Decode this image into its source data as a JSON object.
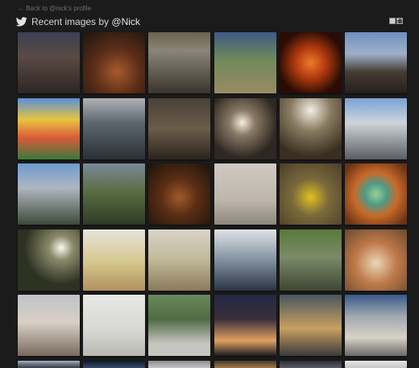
{
  "back_link": "← Back to @nick's profile",
  "header": {
    "title_prefix": "Recent images by ",
    "handle": "@Nick"
  },
  "icons": {
    "brand": "twitter-bird-icon",
    "view_toggle": "grid-view-icon"
  },
  "colors": {
    "background": "#1b1b1b",
    "twitter_bird": "#e2e2e2"
  },
  "thumbnails": [
    {
      "subject": "victorian-houses",
      "bg": "linear-gradient(180deg,#3b3f55 0%,#5a4a44 40%,#2b2724 100%)"
    },
    {
      "subject": "dinner-table",
      "bg": "radial-gradient(circle at 55% 65%,#a85a2c 0%,#5a2d18 45%,#1e1410 100%)"
    },
    {
      "subject": "workshop-sign",
      "bg": "linear-gradient(180deg,#6b6150 0%,#8a8578 30%,#3a342c 100%)"
    },
    {
      "subject": "cabin-in-trees",
      "bg": "linear-gradient(180deg,#3f5a86 0%,#6f8a5a 45%,#9a8a64 100%)"
    },
    {
      "subject": "guy-fawkes-pumpkin",
      "bg": "radial-gradient(circle at 50% 50%,#f07a2a 0%,#b13a0e 35%,#2a0c05 75%)"
    },
    {
      "subject": "festival-crowd",
      "bg": "linear-gradient(180deg,#6f8fbf 0%,#9fb0c8 35%,#463c36 65%,#241e1a 100%)"
    },
    {
      "subject": "cartoon-mural",
      "bg": "linear-gradient(180deg,#5a8fd8 0%,#e8c440 35%,#d85a3a 65%,#3a7a3a 100%)"
    },
    {
      "subject": "parking-garage",
      "bg": "linear-gradient(180deg,#b0b2b4 0%,#5d6770 40%,#2a3034 100%)"
    },
    {
      "subject": "dim-room",
      "bg": "linear-gradient(180deg,#4a4038 0%,#6b5c4a 50%,#2a241e 100%)"
    },
    {
      "subject": "lamp-light",
      "bg": "radial-gradient(circle at 45% 40%,#f6eede 0%,#8a7a66 25%,#2e2822 70%)"
    },
    {
      "subject": "window-backlit",
      "bg": "radial-gradient(circle at 50% 20%,#f2eee4 0%,#8a7c62 35%,#3a2e20 80%)"
    },
    {
      "subject": "office-building",
      "bg": "linear-gradient(180deg,#7aa2d6 0%,#cfd4da 40%,#5a5e62 100%)"
    },
    {
      "subject": "h-sign-building",
      "bg": "linear-gradient(180deg,#6e9ad0 0%,#aeb6bf 40%,#3e4a3a 100%)"
    },
    {
      "subject": "man-in-tshirt",
      "bg": "linear-gradient(180deg,#7a8a9a 0%,#5a6e44 45%,#2e3a22 100%)"
    },
    {
      "subject": "bbq-ribs",
      "bg": "radial-gradient(circle at 50% 55%,#a05a2a 0%,#5a2e14 40%,#1c120c 100%)"
    },
    {
      "subject": "paper-document",
      "bg": "linear-gradient(180deg,#cfcac2 0%,#bdb6aa 60%,#8e877c 100%)"
    },
    {
      "subject": "yellow-shirt",
      "bg": "radial-gradient(circle at 50% 55%,#e0c020 0%,#7a6a3a 40%,#4a3e2a 100%)"
    },
    {
      "subject": "plate-on-table",
      "bg": "radial-gradient(circle at 50% 50%,#9acf9a 0%,#4f9a86 25%,#c86a2a 50%,#6a3214 90%)"
    },
    {
      "subject": "sunburst-trees",
      "bg": "radial-gradient(circle at 70% 30%,#fafaf0 0%,#8a8a6a 20%,#2e3222 60%)"
    },
    {
      "subject": "apple-plate",
      "bg": "linear-gradient(180deg,#e6e4dc 0%,#d4c68a 55%,#b09060 100%)"
    },
    {
      "subject": "food-plate",
      "bg": "linear-gradient(180deg,#d8d4c8 0%,#c0b898 50%,#8a7a5a 100%)"
    },
    {
      "subject": "man-in-office",
      "bg": "linear-gradient(180deg,#dfe2e6 0%,#8b9aa8 45%,#2a3442 100%)"
    },
    {
      "subject": "creek",
      "bg": "linear-gradient(180deg,#5a7a3a 0%,#7a8a6a 45%,#3e4632 100%)"
    },
    {
      "subject": "breakfast-plate",
      "bg": "radial-gradient(circle at 50% 55%,#e8d8b8 0%,#c07a4a 45%,#6a4a2a 100%)"
    },
    {
      "subject": "cartoon-cup",
      "bg": "linear-gradient(180deg,#bfc2c6 0%,#d8d0c6 45%,#7a6a5e 100%)"
    },
    {
      "subject": "green-toy-gun",
      "bg": "linear-gradient(180deg,#e8e8e6 0%,#d6d6d2 60%,#b8b8b2 100%)"
    },
    {
      "subject": "sundial",
      "bg": "linear-gradient(180deg,#6a8a5a 0%,#506a44 40%,#c6c6c0 80%)"
    },
    {
      "subject": "city-night",
      "bg": "linear-gradient(180deg,#232846 0%,#3a2e3a 40%,#e0a060 75%,#1a1a22 100%)"
    },
    {
      "subject": "boots",
      "bg": "linear-gradient(180deg,#4a5660 0%,#c8a060 55%,#3a3a3a 100%)"
    },
    {
      "subject": "storefront",
      "bg": "linear-gradient(180deg,#3a5a8a 0%,#a0a8b0 35%,#d8d2c6 70%,#6a6a6a 100%)"
    },
    {
      "subject": "vintage-car",
      "bg": "linear-gradient(180deg,#aab6c2 0%,#6a7482 45%,#3a3e44 100%)"
    },
    {
      "subject": "partial-1",
      "bg": "linear-gradient(180deg,#0e1a2a 0%,#3a4a6a 100%)"
    },
    {
      "subject": "partial-2",
      "bg": "linear-gradient(180deg,#8a8c8e 0%,#c6c6c6 100%)"
    },
    {
      "subject": "partial-3",
      "bg": "linear-gradient(180deg,#4a3a2a 0%,#9a7a4a 100%)"
    },
    {
      "subject": "partial-4",
      "bg": "linear-gradient(180deg,#2a2e34 0%,#5a5e64 100%)"
    },
    {
      "subject": "partial-5",
      "bg": "linear-gradient(180deg,#e6e6e6 0%,#c6c6c6 100%)"
    },
    {
      "subject": "partial-6",
      "bg": "linear-gradient(180deg,#3a3228 0%,#6a5a44 100%)"
    }
  ]
}
